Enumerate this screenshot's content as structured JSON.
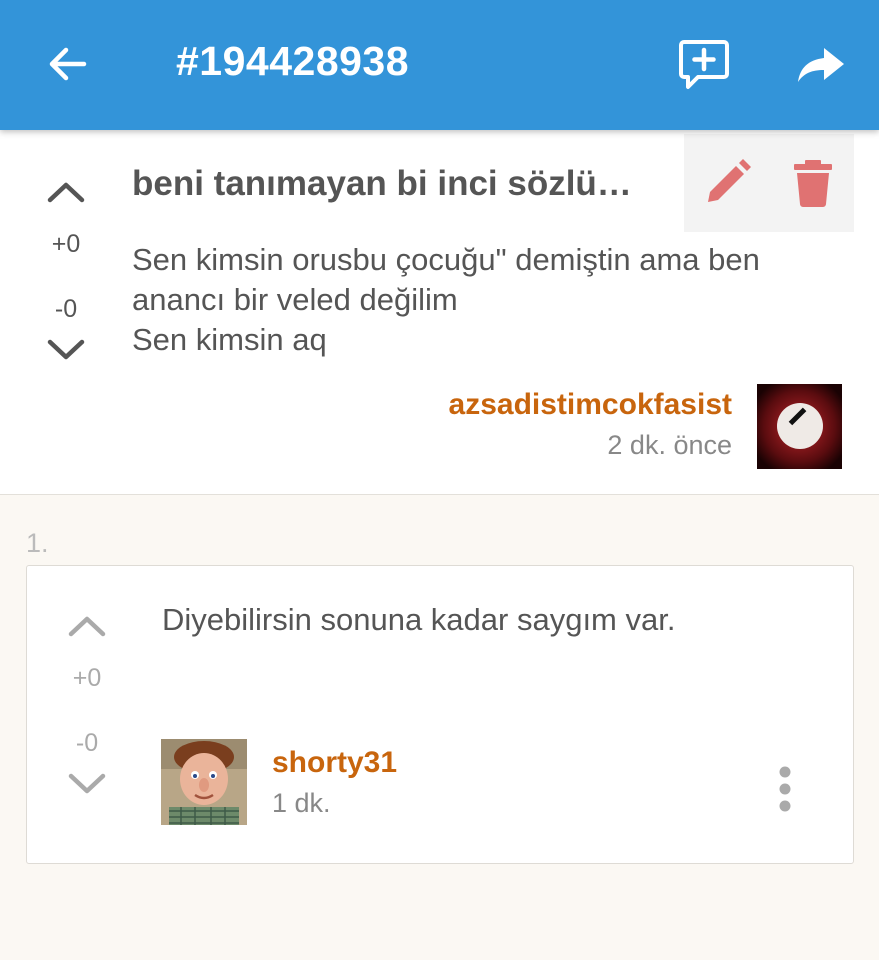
{
  "appbar": {
    "title": "#194428938",
    "back_icon": "arrow-left-icon",
    "new_comment_icon": "comment-plus-icon",
    "share_icon": "share-icon",
    "color": "#3394d9"
  },
  "post": {
    "title": "beni tanımayan bi inci sözlü…",
    "upvotes": "+0",
    "downvotes": "-0",
    "body_lines": [
      "Sen kimsin orusbu çocuğu\" demiştin ama ben",
      "anancı bir veled değilim",
      "Sen kimsin aq"
    ],
    "author": "azsadistimcokfasist",
    "time": "2 dk. önce",
    "edit_icon": "pencil-icon",
    "delete_icon": "trash-icon",
    "action_color": "#e07272"
  },
  "comments": [
    {
      "index": "1.",
      "text": "Diyebilirsin sonuna kadar saygım var.",
      "upvotes": "+0",
      "downvotes": "-0",
      "author": "shorty31",
      "time": "1 dk.",
      "more_icon": "more-vertical-icon"
    }
  ],
  "colors": {
    "author": "#c8650d",
    "background": "#fbf8f3"
  }
}
